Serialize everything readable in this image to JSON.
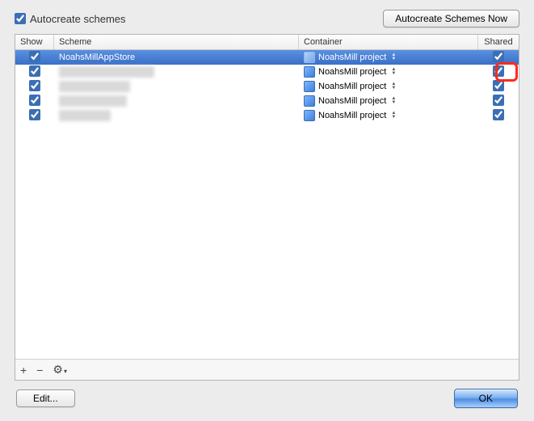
{
  "top": {
    "autocreate_label": "Autocreate schemes",
    "autocreate_checked": true,
    "autocreate_now_btn": "Autocreate Schemes Now"
  },
  "columns": {
    "show": "Show",
    "scheme": "Scheme",
    "container": "Container",
    "shared": "Shared"
  },
  "container_name": "NoahsMill project",
  "rows": [
    {
      "show": true,
      "scheme": "NoahsMillAppStore",
      "container": "NoahsMill project",
      "shared": true,
      "selected": true,
      "blurred": false,
      "blur_w": 0
    },
    {
      "show": true,
      "scheme": "",
      "container": "NoahsMill project",
      "shared": true,
      "selected": false,
      "blurred": true,
      "blur_w": 118
    },
    {
      "show": true,
      "scheme": "",
      "container": "NoahsMill project",
      "shared": true,
      "selected": false,
      "blurred": true,
      "blur_w": 88
    },
    {
      "show": true,
      "scheme": "",
      "container": "NoahsMill project",
      "shared": true,
      "selected": false,
      "blurred": true,
      "blur_w": 84
    },
    {
      "show": true,
      "scheme": "",
      "container": "NoahsMill project",
      "shared": true,
      "selected": false,
      "blurred": true,
      "blur_w": 64
    }
  ],
  "toolbar": {
    "add": "+",
    "remove": "−",
    "gear": "⚙",
    "gear_arrow": "▾"
  },
  "bottom": {
    "edit_btn": "Edit...",
    "ok_btn": "OK"
  }
}
